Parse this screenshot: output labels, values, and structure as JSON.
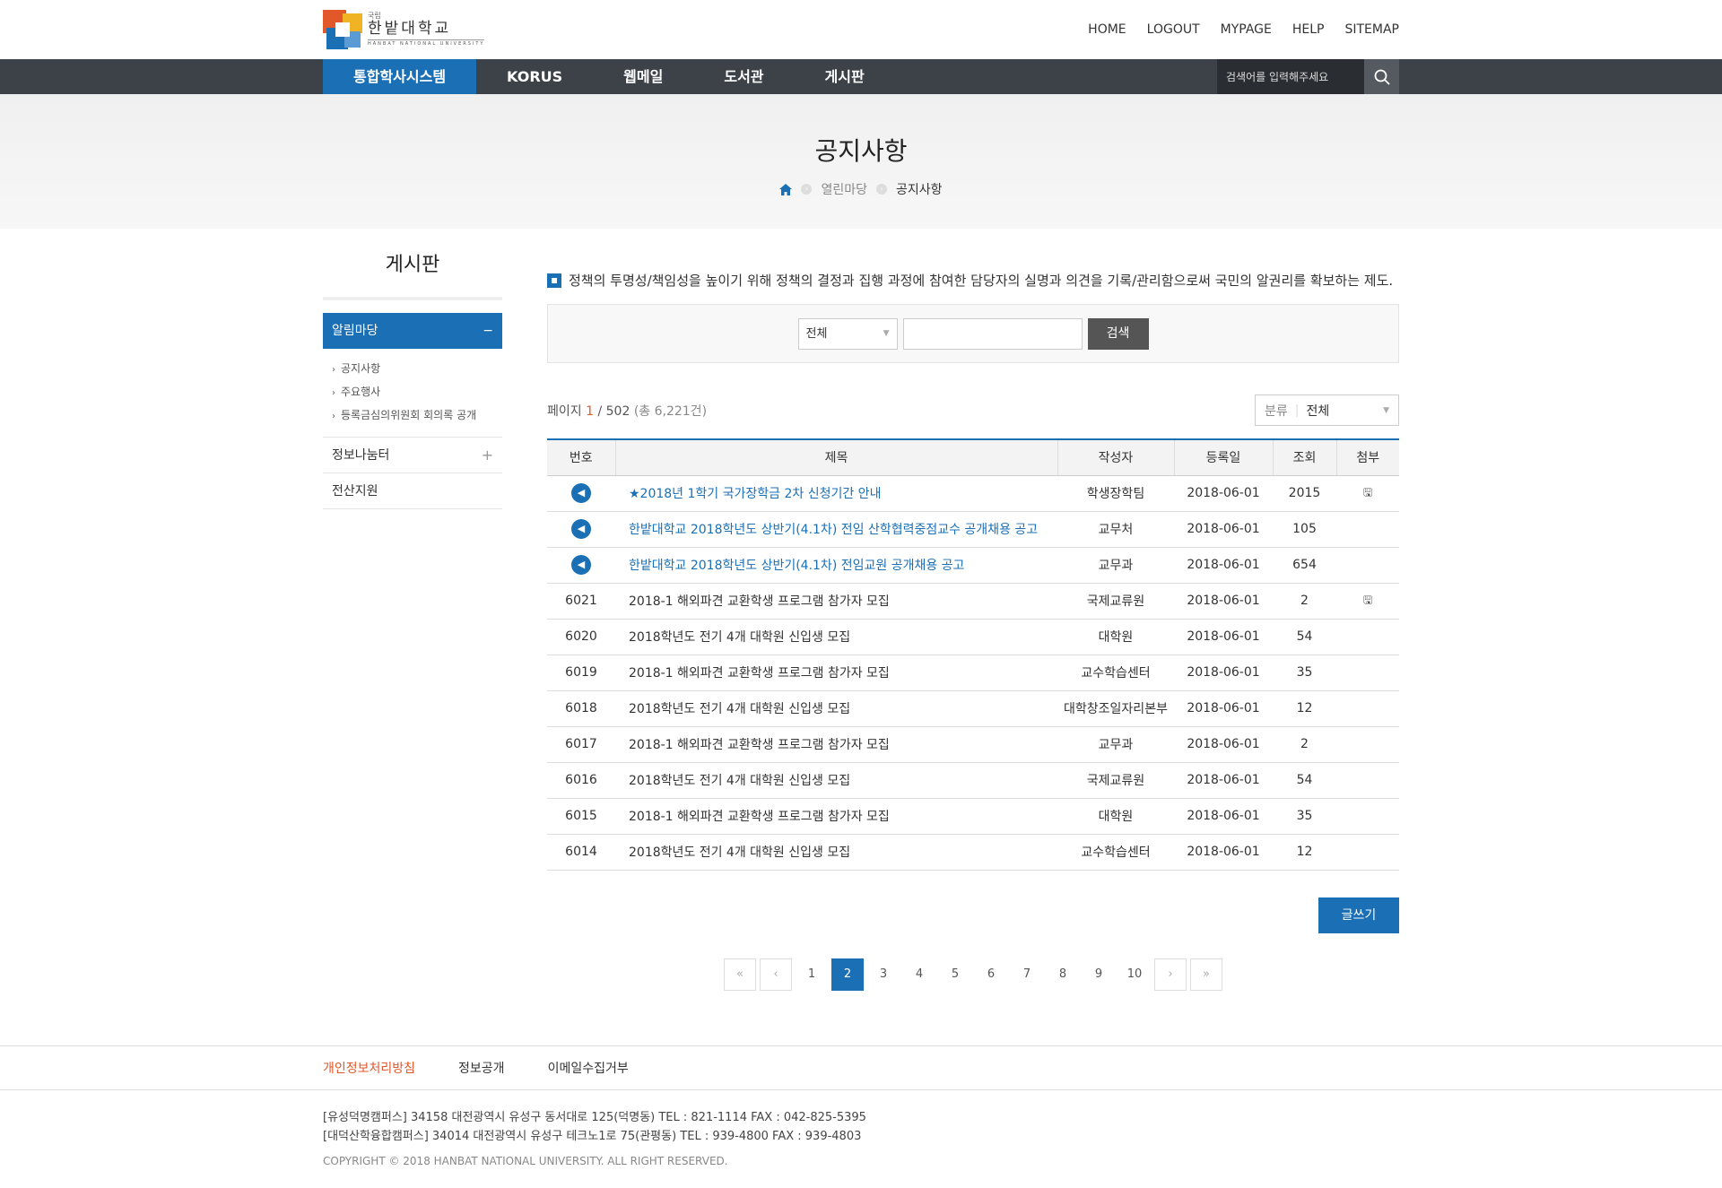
{
  "header": {
    "logo": {
      "small": "국립",
      "kr": "한밭대학교",
      "en": "HANBAT NATIONAL UNIVERSITY"
    },
    "util": [
      "HOME",
      "LOGOUT",
      "MYPAGE",
      "HELP",
      "SITEMAP"
    ]
  },
  "gnb": {
    "items": [
      "통합학사시스템",
      "KORUS",
      "웹메일",
      "도서관",
      "게시판"
    ],
    "search_placeholder": "검색어를 입력해주세요"
  },
  "visual": {
    "title": "공지사항",
    "breadcrumb": [
      "열린마당",
      "공지사항"
    ]
  },
  "lnb": {
    "title": "게시판",
    "active": "알림마당",
    "active_toggle": "−",
    "sub": [
      "공지사항",
      "주요행사",
      "등록금심의위원회 회의록 공개"
    ],
    "items": [
      {
        "label": "정보나눔터",
        "toggle": "+"
      },
      {
        "label": "전산지원",
        "toggle": ""
      }
    ]
  },
  "main": {
    "notice_msg": "정책의 투명성/책임성을 높이기 위해 정책의 결정과 집행 과정에 참여한 담당자의 실명과 의견을 기록/관리함으로써 국민의 알권리를 확보하는 제도.",
    "search": {
      "select": "전체",
      "button": "검색"
    },
    "page_info": {
      "label": "페이지",
      "current": "1",
      "total": "/ 502",
      "count": "(총 6,221건)"
    },
    "category": {
      "label": "분류",
      "value": "전체"
    },
    "table": {
      "headers": [
        "번호",
        "제목",
        "작성자",
        "등록일",
        "조회",
        "첨부"
      ],
      "rows": [
        {
          "no": "",
          "notice": true,
          "title": "★2018년 1학기 국가장학금 2차 신청기간 안내",
          "author": "학생장학팀",
          "date": "2018-06-01",
          "views": "2015",
          "file": true
        },
        {
          "no": "",
          "notice": true,
          "title": "한밭대학교 2018학년도 상반기(4.1차) 전임 산학협력중점교수 공개채용 공고",
          "author": "교무처",
          "date": "2018-06-01",
          "views": "105",
          "file": false
        },
        {
          "no": "",
          "notice": true,
          "title": "한밭대학교 2018학년도 상반기(4.1차) 전임교원 공개채용 공고",
          "author": "교무과",
          "date": "2018-06-01",
          "views": "654",
          "file": false
        },
        {
          "no": "6021",
          "notice": false,
          "title": "2018-1 해외파견 교환학생 프로그램 참가자 모집",
          "author": "국제교류원",
          "date": "2018-06-01",
          "views": "2",
          "file": true
        },
        {
          "no": "6020",
          "notice": false,
          "title": "2018학년도 전기 4개 대학원 신입생 모집",
          "author": "대학원",
          "date": "2018-06-01",
          "views": "54",
          "file": false
        },
        {
          "no": "6019",
          "notice": false,
          "title": "2018-1 해외파견 교환학생 프로그램 참가자 모집",
          "author": "교수학습센터",
          "date": "2018-06-01",
          "views": "35",
          "file": false
        },
        {
          "no": "6018",
          "notice": false,
          "title": "2018학년도 전기 4개 대학원 신입생 모집",
          "author": "대학창조일자리본부",
          "date": "2018-06-01",
          "views": "12",
          "file": false
        },
        {
          "no": "6017",
          "notice": false,
          "title": "2018-1 해외파견 교환학생 프로그램 참가자 모집",
          "author": "교무과",
          "date": "2018-06-01",
          "views": "2",
          "file": false
        },
        {
          "no": "6016",
          "notice": false,
          "title": "2018학년도 전기 4개 대학원 신입생 모집",
          "author": "국제교류원",
          "date": "2018-06-01",
          "views": "54",
          "file": false
        },
        {
          "no": "6015",
          "notice": false,
          "title": "2018-1 해외파견 교환학생 프로그램 참가자 모집",
          "author": "대학원",
          "date": "2018-06-01",
          "views": "35",
          "file": false
        },
        {
          "no": "6014",
          "notice": false,
          "title": "2018학년도 전기 4개 대학원 신입생 모집",
          "author": "교수학습센터",
          "date": "2018-06-01",
          "views": "12",
          "file": false
        }
      ]
    },
    "write_button": "글쓰기",
    "paging": {
      "pages": [
        "1",
        "2",
        "3",
        "4",
        "5",
        "6",
        "7",
        "8",
        "9",
        "10"
      ],
      "active": "2"
    }
  },
  "footer": {
    "links": [
      "개인정보처리방침",
      "정보공개",
      "이메일수집거부"
    ],
    "address1": "[유성덕명캠퍼스] 34158 대전광역시 유성구 동서대로 125(덕명동) TEL : 821-1114 FAX : 042-825-5395",
    "address2": "[대덕산학융합캠퍼스] 34014 대전광역시 유성구 테크노1로 75(관평동) TEL : 939-4800 FAX : 939-4803",
    "copyright": "COPYRIGHT © 2018 HANBAT NATIONAL UNIVERSITY. ALL RIGHT RESERVED."
  },
  "colors": {
    "brand": "#1b6fb5",
    "accent": "#e2582b",
    "gnb": "#3d4249"
  }
}
